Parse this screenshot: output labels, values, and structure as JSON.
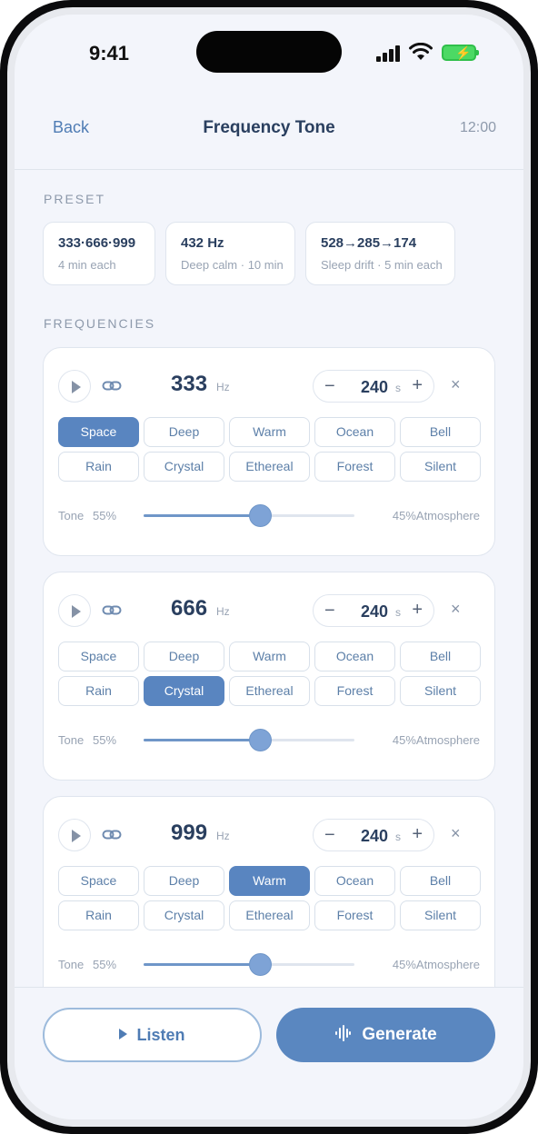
{
  "status_bar": {
    "time": "9:41"
  },
  "nav": {
    "back_label": "Back",
    "title": "Frequency Tone",
    "time_label": "12:00"
  },
  "preset": {
    "section_label": "PRESET",
    "items": [
      {
        "title": "333·666·999",
        "subtitle": "4 min each"
      },
      {
        "title": "432 Hz",
        "subtitle": "Deep calm · 10 min"
      },
      {
        "title": "528→285→174",
        "subtitle": "Sleep drift · 5 min each"
      }
    ]
  },
  "frequencies": {
    "section_label": "FREQUENCIES",
    "hz_unit": "Hz",
    "seconds_unit": "s",
    "minus_symbol": "−",
    "plus_symbol": "+",
    "remove_symbol": "×",
    "tone_label": "Tone",
    "items": [
      {
        "hz": "333",
        "duration": "240",
        "chips": [
          "Space",
          "Deep",
          "Warm",
          "Ocean",
          "Bell",
          "Rain",
          "Crystal",
          "Ethereal",
          "Forest",
          "Silent"
        ],
        "selected_chip": "Space",
        "tone_pct": "55%",
        "atmosphere_label": "45%Atmosphere",
        "tone_level": 0.55
      },
      {
        "hz": "666",
        "duration": "240",
        "chips": [
          "Space",
          "Deep",
          "Warm",
          "Ocean",
          "Bell",
          "Rain",
          "Crystal",
          "Ethereal",
          "Forest",
          "Silent"
        ],
        "selected_chip": "Crystal",
        "tone_pct": "55%",
        "atmosphere_label": "45%Atmosphere",
        "tone_level": 0.55
      },
      {
        "hz": "999",
        "duration": "240",
        "chips": [
          "Space",
          "Deep",
          "Warm",
          "Ocean",
          "Bell",
          "Rain",
          "Crystal",
          "Ethereal",
          "Forest",
          "Silent"
        ],
        "selected_chip": "Warm",
        "tone_pct": "55%",
        "atmosphere_label": "45%Atmosphere",
        "tone_level": 0.55
      }
    ]
  },
  "actions": {
    "listen_label": "Listen",
    "generate_label": "Generate"
  },
  "colors": {
    "accent": "#5a87c0",
    "text": "#2a3f5f",
    "muted": "#98a3b3",
    "background": "#f3f5fb"
  },
  "icons": [
    "play-icon",
    "link-icon",
    "close-icon",
    "waveform-icon",
    "signal-icon",
    "wifi-icon",
    "battery-icon"
  ]
}
